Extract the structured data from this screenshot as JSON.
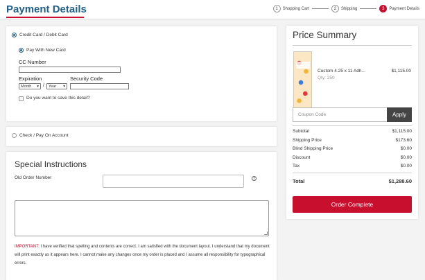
{
  "header": {
    "title": "Payment Details",
    "steps": [
      {
        "num": "1",
        "label": "Shopping Cart"
      },
      {
        "num": "2",
        "label": "Shipping"
      },
      {
        "num": "3",
        "label": "Payment Details"
      }
    ]
  },
  "payment": {
    "credit_label": "Credit Card / Debit Card",
    "new_card_label": "Pay With New Card",
    "cc_number_label": "CC Number",
    "expiration_label": "Expiration",
    "security_label": "Security Code",
    "month_value": "Month",
    "year_value": "Year",
    "slash": "/",
    "save_label": "Do you want to save this detail?",
    "check_label": "Check / Pay On Account"
  },
  "instructions": {
    "title": "Special Instructions",
    "old_order_label": "Old Order Number",
    "help_glyph": "?",
    "important_label": "IMPORTANT:",
    "important_text": " I have verified that spelling and contents are correct. I am satisfied with the document layout. I understand that my document will print exactly as it appears here. I cannot make any changes once my order is placed and I assume all responsibility for typographical errors."
  },
  "summary": {
    "title": "Price Summary",
    "item_name": "Custom 4.25 x 11 Adh...",
    "item_qty": "Qty: 250",
    "item_price": "$1,115.00",
    "coupon_placeholder": "Coupon Code",
    "apply_label": "Apply",
    "subtotal_label": "Subtotal",
    "subtotal_value": "$1,115.00",
    "shipping_label": "Shipping Price",
    "shipping_value": "$173.60",
    "blind_label": "Blind Shipping Price",
    "blind_value": "$0.00",
    "discount_label": "Discount",
    "discount_value": "$0.00",
    "tax_label": "Tax",
    "tax_value": "$0.00",
    "total_label": "Total",
    "total_value": "$1,288.60",
    "complete_label": "Order Complete"
  },
  "colors": {
    "accent_red": "#c8102e",
    "title_blue": "#1f5f8b"
  }
}
